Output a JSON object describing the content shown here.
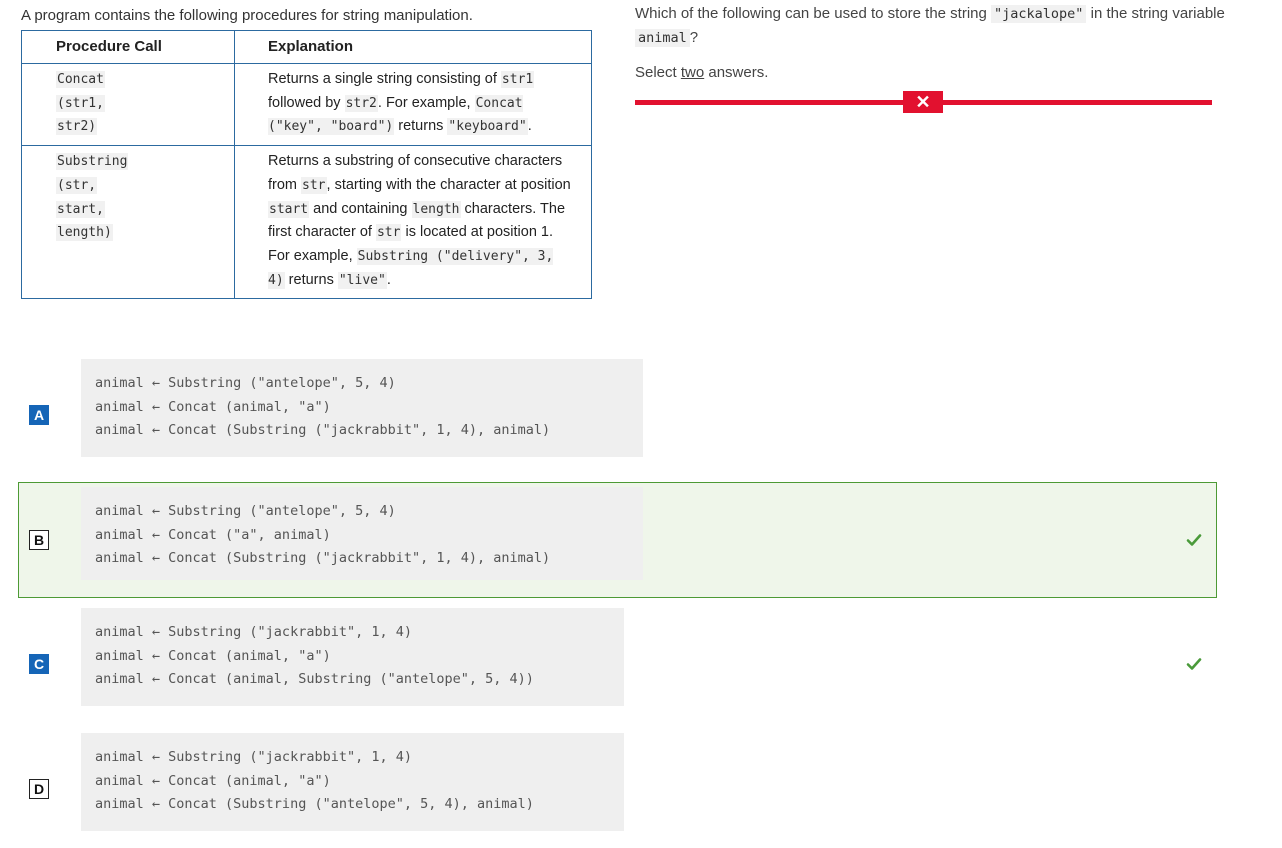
{
  "intro": "A program contains the following procedures for string manipulation.",
  "table": {
    "headers": [
      "Procedure Call",
      "Explanation"
    ],
    "rows": [
      {
        "call_lines": [
          "Concat",
          "(str1,",
          "str2)"
        ],
        "explanation": {
          "t1": "Returns a single string consisting of ",
          "c1": "str1",
          "t2": " followed by ",
          "c2": "str2",
          "t3": ". For example, ",
          "c3": "Concat (\"key\", \"board\")",
          "t4": " returns ",
          "c4": "\"keyboard\"",
          "t5": "."
        }
      },
      {
        "call_lines": [
          "Substring",
          "(str,",
          "start,",
          "length)"
        ],
        "explanation": {
          "t1": "Returns a substring of consecutive characters from ",
          "c1": "str",
          "t2": ", starting with the character at position ",
          "c2": "start",
          "t3": " and containing ",
          "c3": "length",
          "t4": " characters. The first character of ",
          "c4": "str",
          "t5": " is located at position 1. For example, ",
          "c5": "Substring (\"delivery\", 3, 4)",
          "t6": " returns ",
          "c6": "\"live\"",
          "t7": "."
        }
      }
    ]
  },
  "question": {
    "t1": "Which of the following can be used to store the string ",
    "c1": "\"jackalope\"",
    "t2": " in the string variable ",
    "c2": "animal",
    "t3": "?",
    "hint_pre": "Select ",
    "hint_two": "two",
    "hint_post": " answers.",
    "wrong_mark": "✕"
  },
  "options": [
    {
      "letter": "A",
      "lines": [
        "animal ← Substring (\"antelope\", 5, 4)",
        "animal ← Concat (animal, \"a\")",
        "animal ← Concat (Substring (\"jackrabbit\", 1, 4), animal)"
      ],
      "correct": false
    },
    {
      "letter": "B",
      "lines": [
        "animal ← Substring (\"antelope\", 5, 4)",
        "animal ← Concat (\"a\", animal)",
        "animal ← Concat (Substring (\"jackrabbit\", 1, 4), animal)"
      ],
      "correct": true
    },
    {
      "letter": "C",
      "lines": [
        "animal ← Substring (\"jackrabbit\", 1, 4)",
        "animal ← Concat (animal, \"a\")",
        "animal ← Concat (animal, Substring (\"antelope\", 5, 4))"
      ],
      "correct": true
    },
    {
      "letter": "D",
      "lines": [
        "animal ← Substring (\"jackrabbit\", 1, 4)",
        "animal ← Concat (animal, \"a\")",
        "animal ← Concat (Substring (\"antelope\", 5, 4), animal)"
      ],
      "correct": false
    }
  ],
  "colors": {
    "selected_letter": "#1565b7",
    "wrong_bar": "#e2112f",
    "correct_border": "#4d9a35",
    "check": "#4a9a3a"
  },
  "icons": {
    "check": "check-icon",
    "wrong": "close-icon"
  }
}
